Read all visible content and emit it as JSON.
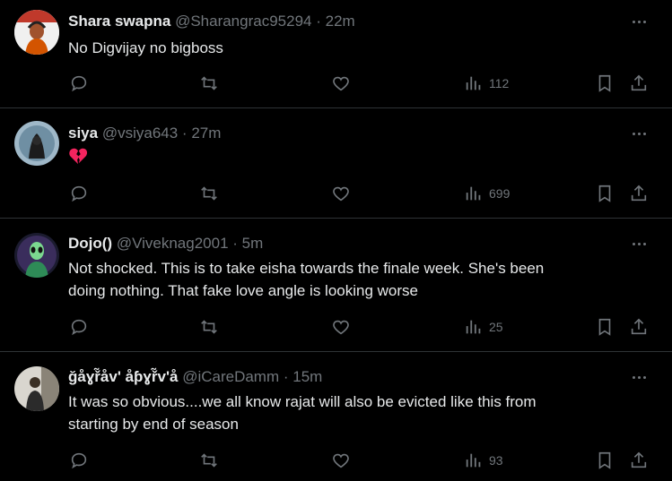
{
  "tweets": [
    {
      "name": "Shara swapna",
      "handle": "@Sharangrac95294",
      "dot": "·",
      "time": "22m",
      "text": "No Digvijay no bigboss",
      "views": "112",
      "avatar": "avatar-photo"
    },
    {
      "name": "siya",
      "handle": "@vsiya643",
      "dot": "·",
      "time": "27m",
      "text": "",
      "emoji": "broken-heart",
      "views": "699",
      "avatar": "avatar-art"
    },
    {
      "name": "Dojo()",
      "handle": "@Viveknag2001",
      "dot": "·",
      "time": "5m",
      "text_lines": [
        "Not shocked. This is to take eisha towards the finale week. She's been",
        "doing nothing. That fake love angle is looking worse"
      ],
      "views": "25",
      "avatar": "avatar-alien"
    },
    {
      "name": "ğåɣř̃åv' åƥɣř̃v'å",
      "handle": "@iCareDamm",
      "dot": "·",
      "time": "15m",
      "text_lines": [
        "It was so obvious....we all know rajat will also be evicted like this from",
        "starting by end of season"
      ],
      "views": "93",
      "avatar": "avatar-person"
    }
  ],
  "colors": {
    "background": "#000000",
    "text": "#e7e9ea",
    "muted": "#71767b",
    "divider": "#2f3336",
    "broken_heart": "#f4245e"
  }
}
